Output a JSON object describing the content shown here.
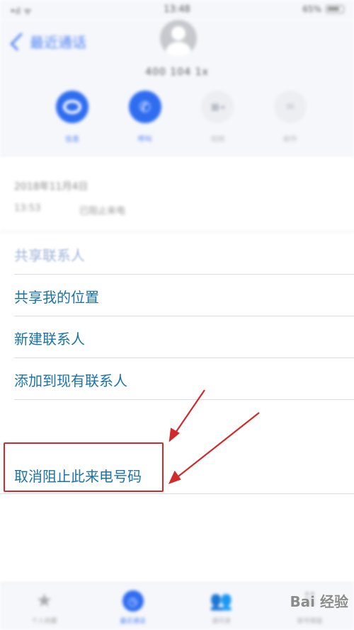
{
  "status_bar": {
    "carrier": "•ıl ᯤ",
    "time": "13:48",
    "battery": "65%"
  },
  "header": {
    "back_label": "最近通话",
    "caller_number": "400 104 1x",
    "actions": [
      {
        "label": "信息",
        "active": true
      },
      {
        "label": "呼叫",
        "active": true
      },
      {
        "label": "视频",
        "active": false
      },
      {
        "label": "邮件",
        "active": false
      }
    ]
  },
  "call_info": {
    "date": "2018年11月4日",
    "time": "13:53",
    "status": "已阻止来电"
  },
  "menu": {
    "share_contact": "共享联系人",
    "share_location": "共享我的位置",
    "new_contact": "新建联系人",
    "add_existing": "添加到现有联系人",
    "unblock": "取消阻止此来电号码"
  },
  "tabbar": {
    "items": [
      {
        "label": "个人收藏",
        "icon": "star-icon"
      },
      {
        "label": "最近通话",
        "icon": "clock-icon",
        "active": true
      },
      {
        "label": "通讯录",
        "icon": "contacts-icon"
      },
      {
        "label": "拨号键盘",
        "icon": "keypad-icon"
      }
    ]
  },
  "watermark": "Bai 经验",
  "colors": {
    "accent": "#2f6df0",
    "link": "#1a73a8",
    "annotation": "#d22a2a"
  }
}
